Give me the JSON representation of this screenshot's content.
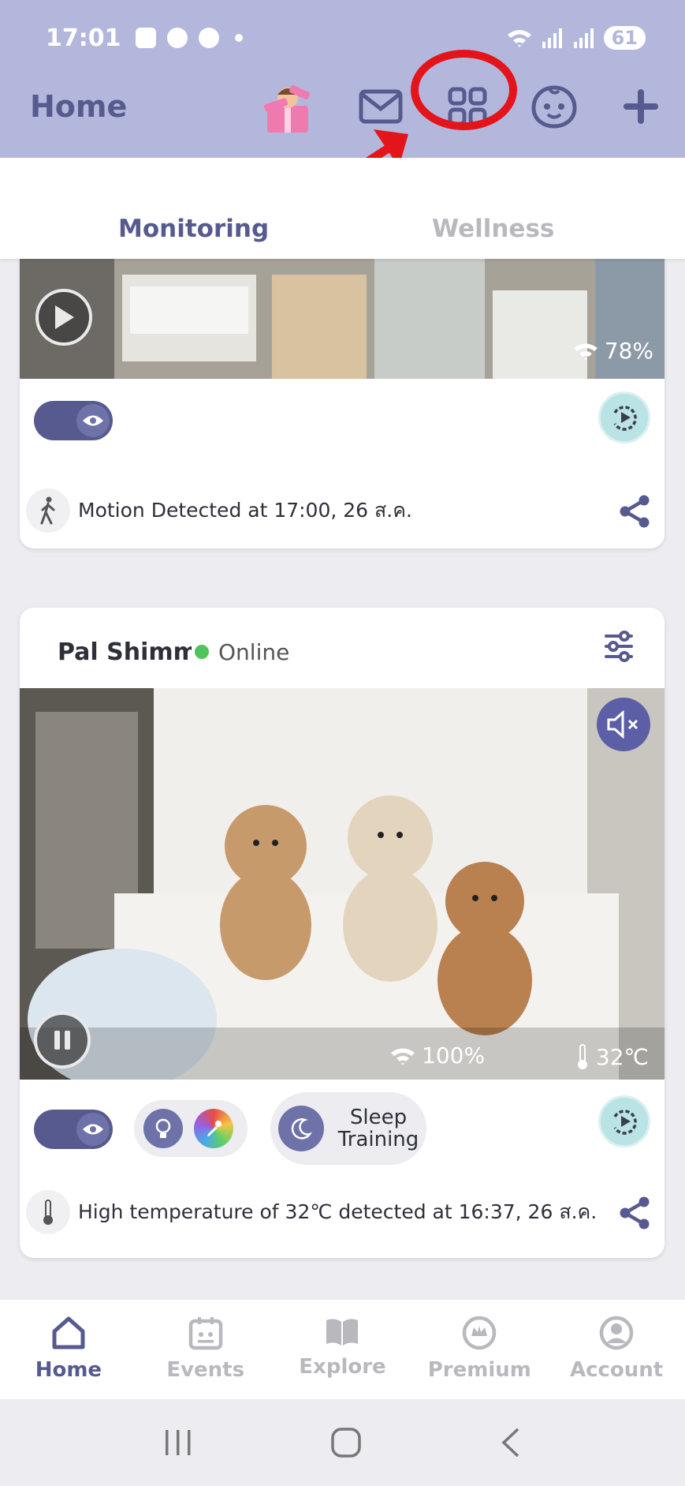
{
  "status_bar": {
    "time": "17:01",
    "battery": "61"
  },
  "header": {
    "title": "Home",
    "icons": [
      "gift-icon",
      "mail-icon",
      "grid-icon",
      "baby-face-icon",
      "plus-icon"
    ],
    "annotation": {
      "color": "#e4141b",
      "target": "grid-icon"
    }
  },
  "tabs": [
    {
      "label": "Monitoring",
      "active": true
    },
    {
      "label": "Wellness",
      "active": false
    }
  ],
  "camera1": {
    "wifi": "78%",
    "event": "Motion Detected at 17:00, 26 ส.ค."
  },
  "camera2": {
    "name": "Pal Shimmer",
    "status": "Online",
    "wifi": "100%",
    "temperature": "32℃",
    "sleep_training_line1": "Sleep",
    "sleep_training_line2": "Training",
    "event": "High temperature of 32℃ detected at 16:37, 26 ส.ค."
  },
  "bottom_nav": [
    {
      "label": "Home",
      "icon": "home-icon",
      "active": true
    },
    {
      "label": "Events",
      "icon": "calendar-icon",
      "active": false
    },
    {
      "label": "Explore",
      "icon": "book-icon",
      "active": false
    },
    {
      "label": "Premium",
      "icon": "premium-icon",
      "active": false
    },
    {
      "label": "Account",
      "icon": "account-icon",
      "active": false
    }
  ],
  "colors": {
    "primary": "#575a8e",
    "header_bg": "#b4b7dc",
    "online": "#4fc45a",
    "accent_teal": "#b9e3e5"
  }
}
